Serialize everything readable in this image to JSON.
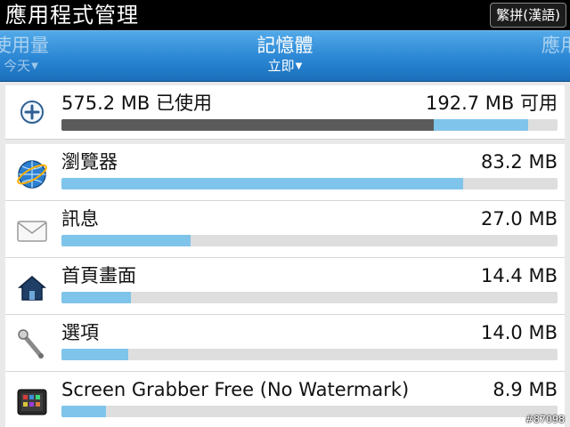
{
  "titlebar": {
    "title": "應用程式管理",
    "ime_label": "繁拼(漢語)"
  },
  "tabs": {
    "left": {
      "label": "使用量",
      "sub": "今天"
    },
    "center": {
      "label": "記憶體",
      "sub": "立即"
    },
    "right": {
      "label": "應用"
    }
  },
  "summary": {
    "used_text": "575.2 MB 已使用",
    "available_text": "192.7 MB 可用",
    "used_fraction": 0.75,
    "extra_fraction": 0.19
  },
  "apps": [
    {
      "name": "瀏覽器",
      "size": "83.2 MB",
      "fraction": 0.81,
      "icon": "browser-globe-icon"
    },
    {
      "name": "訊息",
      "size": "27.0 MB",
      "fraction": 0.26,
      "icon": "messages-envelope-icon"
    },
    {
      "name": "首頁畫面",
      "size": "14.4 MB",
      "fraction": 0.14,
      "icon": "home-screen-icon"
    },
    {
      "name": "選項",
      "size": "14.0 MB",
      "fraction": 0.135,
      "icon": "options-wrench-icon"
    },
    {
      "name": "Screen Grabber Free (No Watermark)",
      "size": "8.9 MB",
      "fraction": 0.09,
      "icon": "screen-grabber-icon"
    }
  ],
  "watermark": "#87098"
}
